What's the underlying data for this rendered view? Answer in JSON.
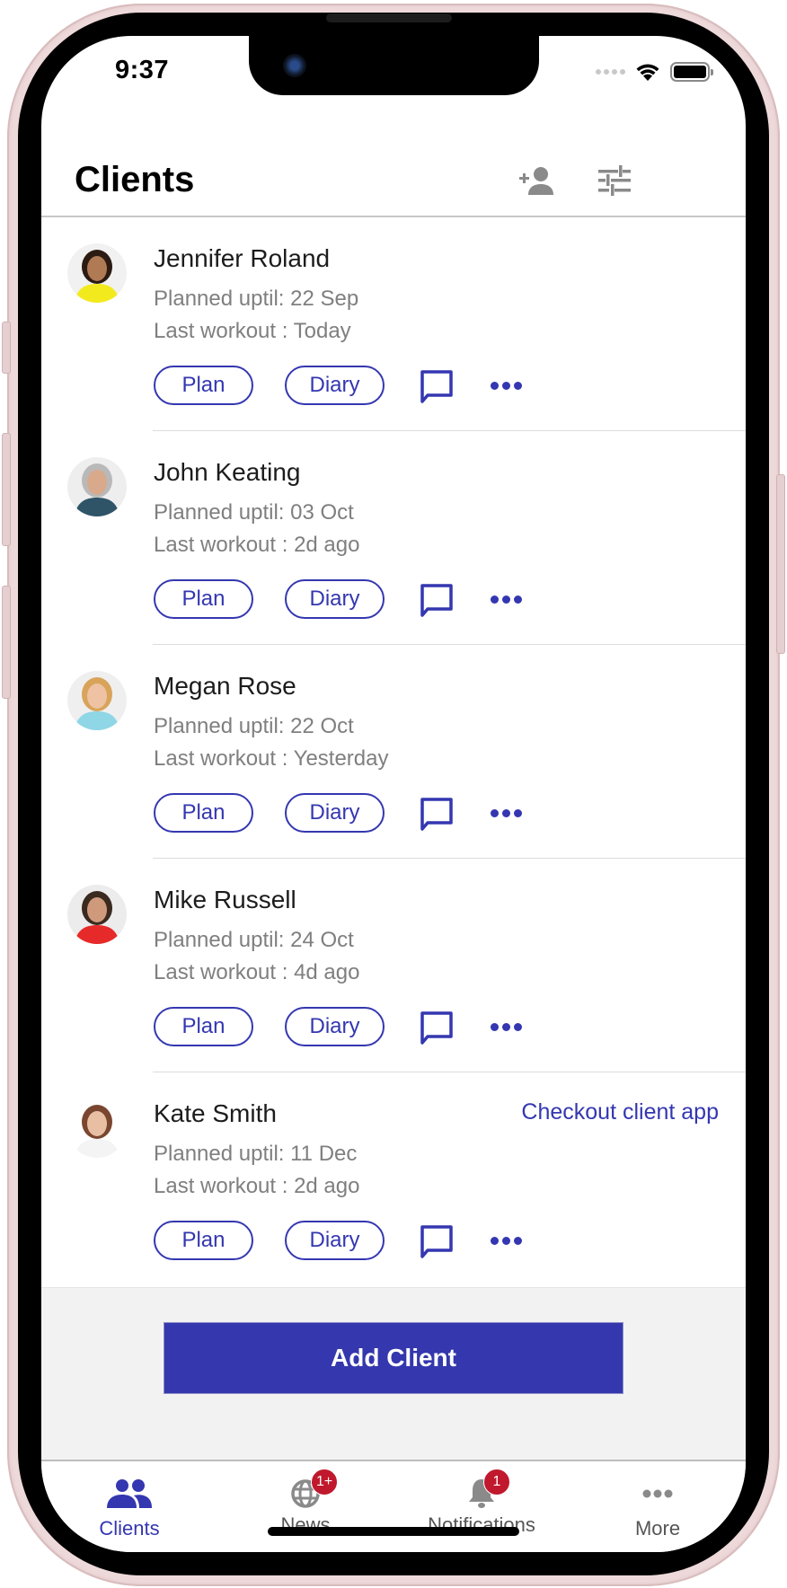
{
  "status_bar": {
    "time": "9:37"
  },
  "header": {
    "title": "Clients",
    "add_client_icon": "person-add-icon",
    "filter_icon": "tune-sliders-icon"
  },
  "clients": [
    {
      "name": "Jennifer Roland",
      "planned": "Planned uptil: 22 Sep",
      "last_workout": "Last workout : Today",
      "plan_label": "Plan",
      "diary_label": "Diary",
      "avatar_colors": {
        "bg": "#f1f1f1",
        "hair": "#2c1b12",
        "skin": "#b07a55",
        "shirt": "#f3ea1e"
      }
    },
    {
      "name": "John Keating",
      "planned": "Planned uptil: 03 Oct",
      "last_workout": "Last workout : 2d ago",
      "plan_label": "Plan",
      "diary_label": "Diary",
      "avatar_colors": {
        "bg": "#eeeeee",
        "hair": "#b9b9b9",
        "skin": "#d9a98b",
        "shirt": "#2f5468"
      }
    },
    {
      "name": "Megan Rose",
      "planned": "Planned uptil: 22 Oct",
      "last_workout": "Last workout : Yesterday",
      "plan_label": "Plan",
      "diary_label": "Diary",
      "avatar_colors": {
        "bg": "#efefef",
        "hair": "#d8a45a",
        "skin": "#eec2a2",
        "shirt": "#8fd6e6"
      }
    },
    {
      "name": "Mike Russell",
      "planned": "Planned uptil: 24 Oct",
      "last_workout": "Last workout : 4d ago",
      "plan_label": "Plan",
      "diary_label": "Diary",
      "avatar_colors": {
        "bg": "#ececec",
        "hair": "#3a2a20",
        "skin": "#cf9a7c",
        "shirt": "#e62a2a"
      }
    },
    {
      "name": "Kate Smith",
      "planned": "Planned uptil: 11 Dec",
      "last_workout": "Last workout : 2d ago",
      "plan_label": "Plan",
      "diary_label": "Diary",
      "checkout_link": "Checkout client app",
      "avatar_colors": {
        "bg": "#ffffff",
        "hair": "#7a4630",
        "skin": "#e9bfa4",
        "shirt": "#f4f4f4"
      }
    }
  ],
  "add_client_button": "Add Client",
  "tabs": [
    {
      "label": "Clients",
      "icon": "people-icon",
      "active": true
    },
    {
      "label": "News",
      "icon": "globe-icon",
      "badge": "1+"
    },
    {
      "label": "Notifications",
      "icon": "bell-icon",
      "badge": "1"
    },
    {
      "label": "More",
      "icon": "more-horizontal-icon"
    }
  ],
  "colors": {
    "accent": "#3437b0",
    "badge": "#c0182c",
    "muted_text": "#7f7f7f",
    "icon_gray": "#8a8a8a"
  }
}
